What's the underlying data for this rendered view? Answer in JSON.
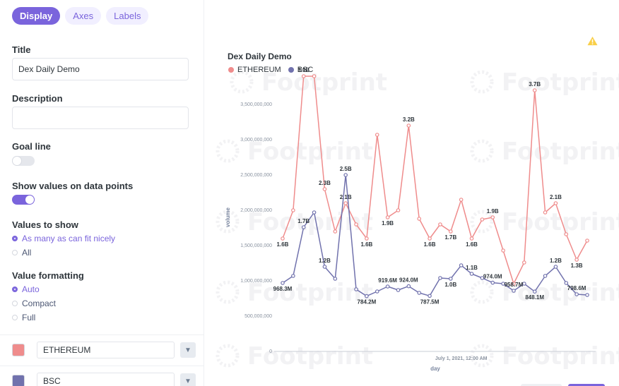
{
  "tabs": [
    {
      "label": "Display",
      "active": true
    },
    {
      "label": "Axes",
      "active": false
    },
    {
      "label": "Labels",
      "active": false
    }
  ],
  "settings": {
    "title_label": "Title",
    "title_value": "Dex Daily  Demo",
    "description_label": "Description",
    "description_value": "",
    "goal_line_label": "Goal line",
    "goal_line_on": false,
    "show_values_label": "Show values on data points",
    "show_values_on": true,
    "values_to_show_label": "Values to show",
    "values_to_show_options": [
      "As many as can fit nicely",
      "All"
    ],
    "values_to_show_selected": "As many as can fit nicely",
    "value_formatting_label": "Value formatting",
    "value_formatting_options": [
      "Auto",
      "Compact",
      "Full"
    ],
    "value_formatting_selected": "Auto"
  },
  "series_settings": [
    {
      "name": "ETHEREUM",
      "color": "#ef8c8c"
    },
    {
      "name": "BSC",
      "color": "#7172ad"
    }
  ],
  "colors": {
    "accent": "#7a64dc",
    "warning": "#f9cf48"
  },
  "chart_data": {
    "type": "line",
    "title": "Dex Daily Demo",
    "xlabel": "day",
    "ylabel": "volume",
    "ylim": [
      0,
      3900000000
    ],
    "yticks": [
      {
        "v": 0,
        "label": "0"
      },
      {
        "v": 500000000,
        "label": "500,000,000"
      },
      {
        "v": 1000000000,
        "label": "1,000,000,000"
      },
      {
        "v": 1500000000,
        "label": "1,500,000,000"
      },
      {
        "v": 2000000000,
        "label": "2,000,000,000"
      },
      {
        "v": 2500000000,
        "label": "2,500,000,000"
      },
      {
        "v": 3000000000,
        "label": "3,000,000,000"
      },
      {
        "v": 3500000000,
        "label": "3,500,000,000"
      }
    ],
    "x_tick_label": "July 1, 2021, 12:00 AM",
    "x_tick_index": 17,
    "grid": true,
    "legend_position": "top-left",
    "series": [
      {
        "name": "ETHEREUM",
        "color": "#ef8c8c",
        "values": [
          1600000000.0,
          2000000000.0,
          3900000000.0,
          3900000000.0,
          2300000000.0,
          1700000000.0,
          2100000000.0,
          1800000000.0,
          1600000000.0,
          3070000000.0,
          1900000000.0,
          2000000000.0,
          3200000000.0,
          1880000000.0,
          1600000000.0,
          1800000000.0,
          1700000000.0,
          2150000000.0,
          1600000000.0,
          1870000000.0,
          1900000000.0,
          1430000000.0,
          960000000.0,
          1260000000.0,
          3700000000.0,
          1970000000.0,
          2100000000.0,
          1660000000.0,
          1300000000.0,
          1570000000.0
        ],
        "labels": [
          {
            "i": 0,
            "text": "1.6B",
            "pos": "below"
          },
          {
            "i": 2,
            "text": "3.9B",
            "pos": "above"
          },
          {
            "i": 4,
            "text": "2.3B",
            "pos": "above"
          },
          {
            "i": 6,
            "text": "2.1B",
            "pos": "above"
          },
          {
            "i": 8,
            "text": "1.6B",
            "pos": "below"
          },
          {
            "i": 10,
            "text": "1.9B",
            "pos": "below"
          },
          {
            "i": 12,
            "text": "3.2B",
            "pos": "above"
          },
          {
            "i": 14,
            "text": "1.6B",
            "pos": "below"
          },
          {
            "i": 16,
            "text": "1.7B",
            "pos": "below"
          },
          {
            "i": 18,
            "text": "1.6B",
            "pos": "below"
          },
          {
            "i": 20,
            "text": "1.9B",
            "pos": "above"
          },
          {
            "i": 24,
            "text": "3.7B",
            "pos": "above"
          },
          {
            "i": 26,
            "text": "2.1B",
            "pos": "above"
          },
          {
            "i": 28,
            "text": "1.3B",
            "pos": "below"
          }
        ]
      },
      {
        "name": "BSC",
        "color": "#7172ad",
        "values": [
          970000000.0,
          1070000000.0,
          1760000000.0,
          1970000000.0,
          1200000000.0,
          1030000000.0,
          2500000000.0,
          880000000.0,
          784000000.0,
          850000000.0,
          920000000.0,
          870000000.0,
          924000000.0,
          830000000.0,
          787000000.0,
          1040000000.0,
          1030000000.0,
          1220000000.0,
          1100000000.0,
          1040000000.0,
          974000000.0,
          960000000.0,
          860000000.0,
          960000000.0,
          848000000.0,
          1070000000.0,
          1200000000.0,
          970000000.0,
          810000000.0,
          800000000.0
        ],
        "labels": [
          {
            "i": 0,
            "text": "968.3M",
            "pos": "below"
          },
          {
            "i": 2,
            "text": "1.7B",
            "pos": "above"
          },
          {
            "i": 4,
            "text": "1.2B",
            "pos": "above"
          },
          {
            "i": 6,
            "text": "2.5B",
            "pos": "above"
          },
          {
            "i": 8,
            "text": "784.2M",
            "pos": "below"
          },
          {
            "i": 10,
            "text": "919.6M",
            "pos": "above"
          },
          {
            "i": 12,
            "text": "924.0M",
            "pos": "above"
          },
          {
            "i": 14,
            "text": "787.5M",
            "pos": "below"
          },
          {
            "i": 16,
            "text": "1.0B",
            "pos": "below"
          },
          {
            "i": 18,
            "text": "1.1B",
            "pos": "above"
          },
          {
            "i": 20,
            "text": "974.0M",
            "pos": "above"
          },
          {
            "i": 22,
            "text": "958.7M",
            "pos": "above"
          },
          {
            "i": 24,
            "text": "848.1M",
            "pos": "below"
          },
          {
            "i": 26,
            "text": "1.2B",
            "pos": "above"
          },
          {
            "i": 28,
            "text": "798.6M",
            "pos": "above"
          }
        ]
      }
    ]
  },
  "watermark_text": "Footprint"
}
